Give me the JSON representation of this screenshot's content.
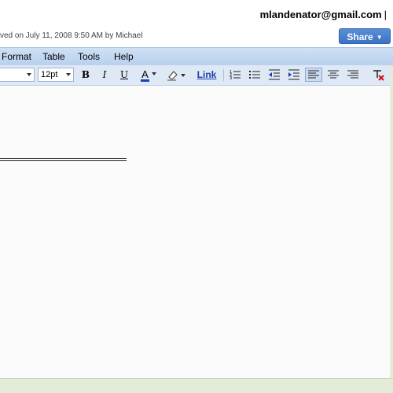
{
  "header": {
    "user_email": "mlandenator@gmail.com",
    "saved_status": "ved on July 11, 2008 9:50 AM by Michael",
    "share_label": "Share"
  },
  "menu": {
    "items": [
      "Format",
      "Table",
      "Tools",
      "Help"
    ]
  },
  "toolbar": {
    "font_size": "12pt",
    "bold_label": "B",
    "italic_label": "I",
    "underline_label": "U",
    "text_color_label": "A",
    "link_label": "Link",
    "active_alignment": "align-left"
  },
  "colors": {
    "menubar": "#c4d8f1",
    "share_button": "#3c73c4",
    "text_color_bar": "#1a3fb0",
    "remove_format_red": "#cc1111"
  }
}
